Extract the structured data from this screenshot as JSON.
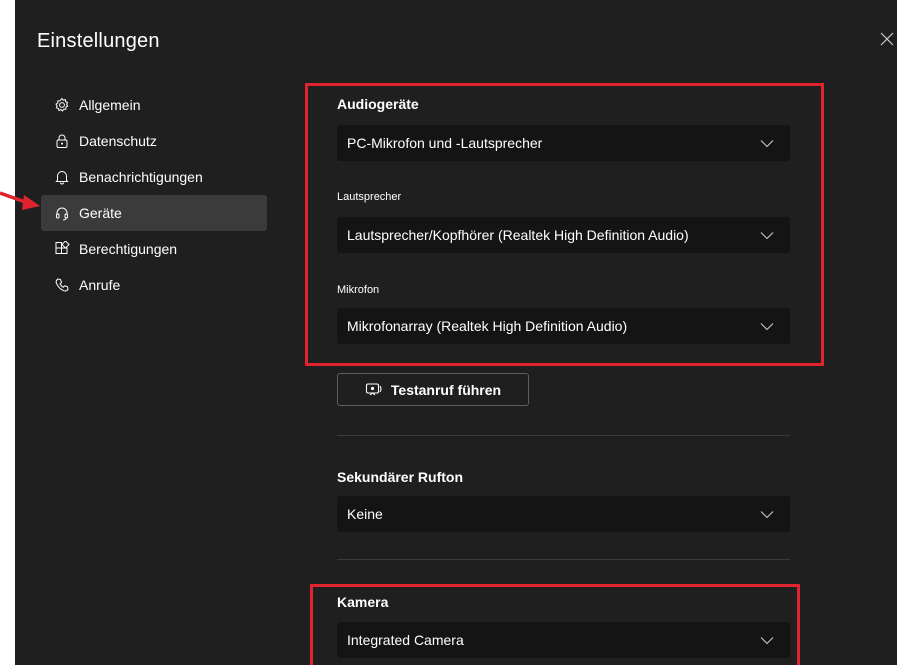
{
  "dialog": {
    "title": "Einstellungen"
  },
  "nav": {
    "items": [
      {
        "label": "Allgemein",
        "icon": "gear-icon"
      },
      {
        "label": "Datenschutz",
        "icon": "lock-icon"
      },
      {
        "label": "Benachrichtigungen",
        "icon": "bell-icon"
      },
      {
        "label": "Geräte",
        "icon": "headset-icon",
        "active": true
      },
      {
        "label": "Berechtigungen",
        "icon": "apps-icon"
      },
      {
        "label": "Anrufe",
        "icon": "phone-icon"
      }
    ]
  },
  "audio": {
    "heading": "Audiogeräte",
    "device": "PC-Mikrofon und -Lautsprecher",
    "speaker_label": "Lautsprecher",
    "speaker": "Lautsprecher/Kopfhörer (Realtek High Definition Audio)",
    "mic_label": "Mikrofon",
    "mic": "Mikrofonarray (Realtek High Definition Audio)",
    "test_call": "Testanruf führen"
  },
  "secondary_ring": {
    "heading": "Sekundärer Rufton",
    "value": "Keine"
  },
  "camera": {
    "heading": "Kamera",
    "value": "Integrated Camera"
  },
  "colors": {
    "background": "#1f1f1f",
    "select_bg": "#141414",
    "active_nav": "#3b3b3b",
    "annotation_red": "#e0232e"
  }
}
